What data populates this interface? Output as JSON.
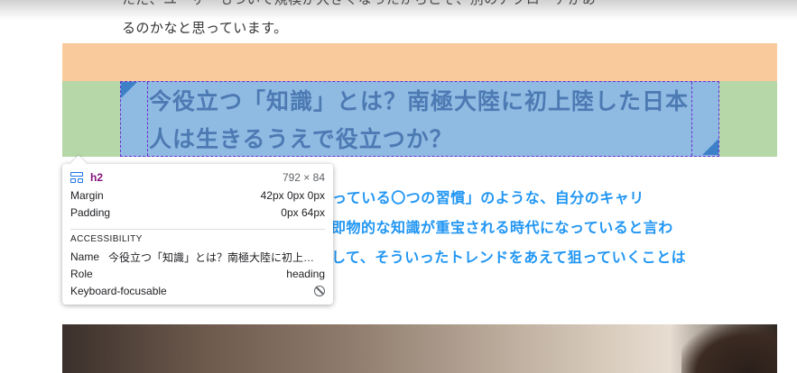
{
  "article": {
    "intro_line1": "ただ、ユーザーもついて規模が大きくなったからこそ、別のアプローチがあ",
    "intro_line2": "るのかなと思っています。",
    "heading": "今役立つ「知識」とは？南極大陸に初上陸した日本人は生きるうえで役立つか？",
    "body_line1": "のやっている〇つの習慣」のような、自分のキャリ",
    "body_line2": "即物的な知識が重宝される時代になっていると言わ",
    "body_line3": "して、そういったトレンドをあえて狙っていくことは"
  },
  "inspector_overlay": {
    "margin_color": "#f9cb9c",
    "padding_color": "#b6d7a8",
    "content_color": "#8fbbe3"
  },
  "tooltip": {
    "tag": "h2",
    "dimensions": "792 × 84",
    "margin_label": "Margin",
    "margin_value": "42px 0px 0px",
    "padding_label": "Padding",
    "padding_value": "0px 64px",
    "section_title": "ACCESSIBILITY",
    "name_label": "Name",
    "name_value": "今役立つ「知識」とは？南極大陸に初上陸した日本人は生きるうえで役立つか？",
    "role_label": "Role",
    "role_value": "heading",
    "focusable_label": "Keyboard-focusable",
    "focusable_icon": "not-allowed-icon"
  }
}
